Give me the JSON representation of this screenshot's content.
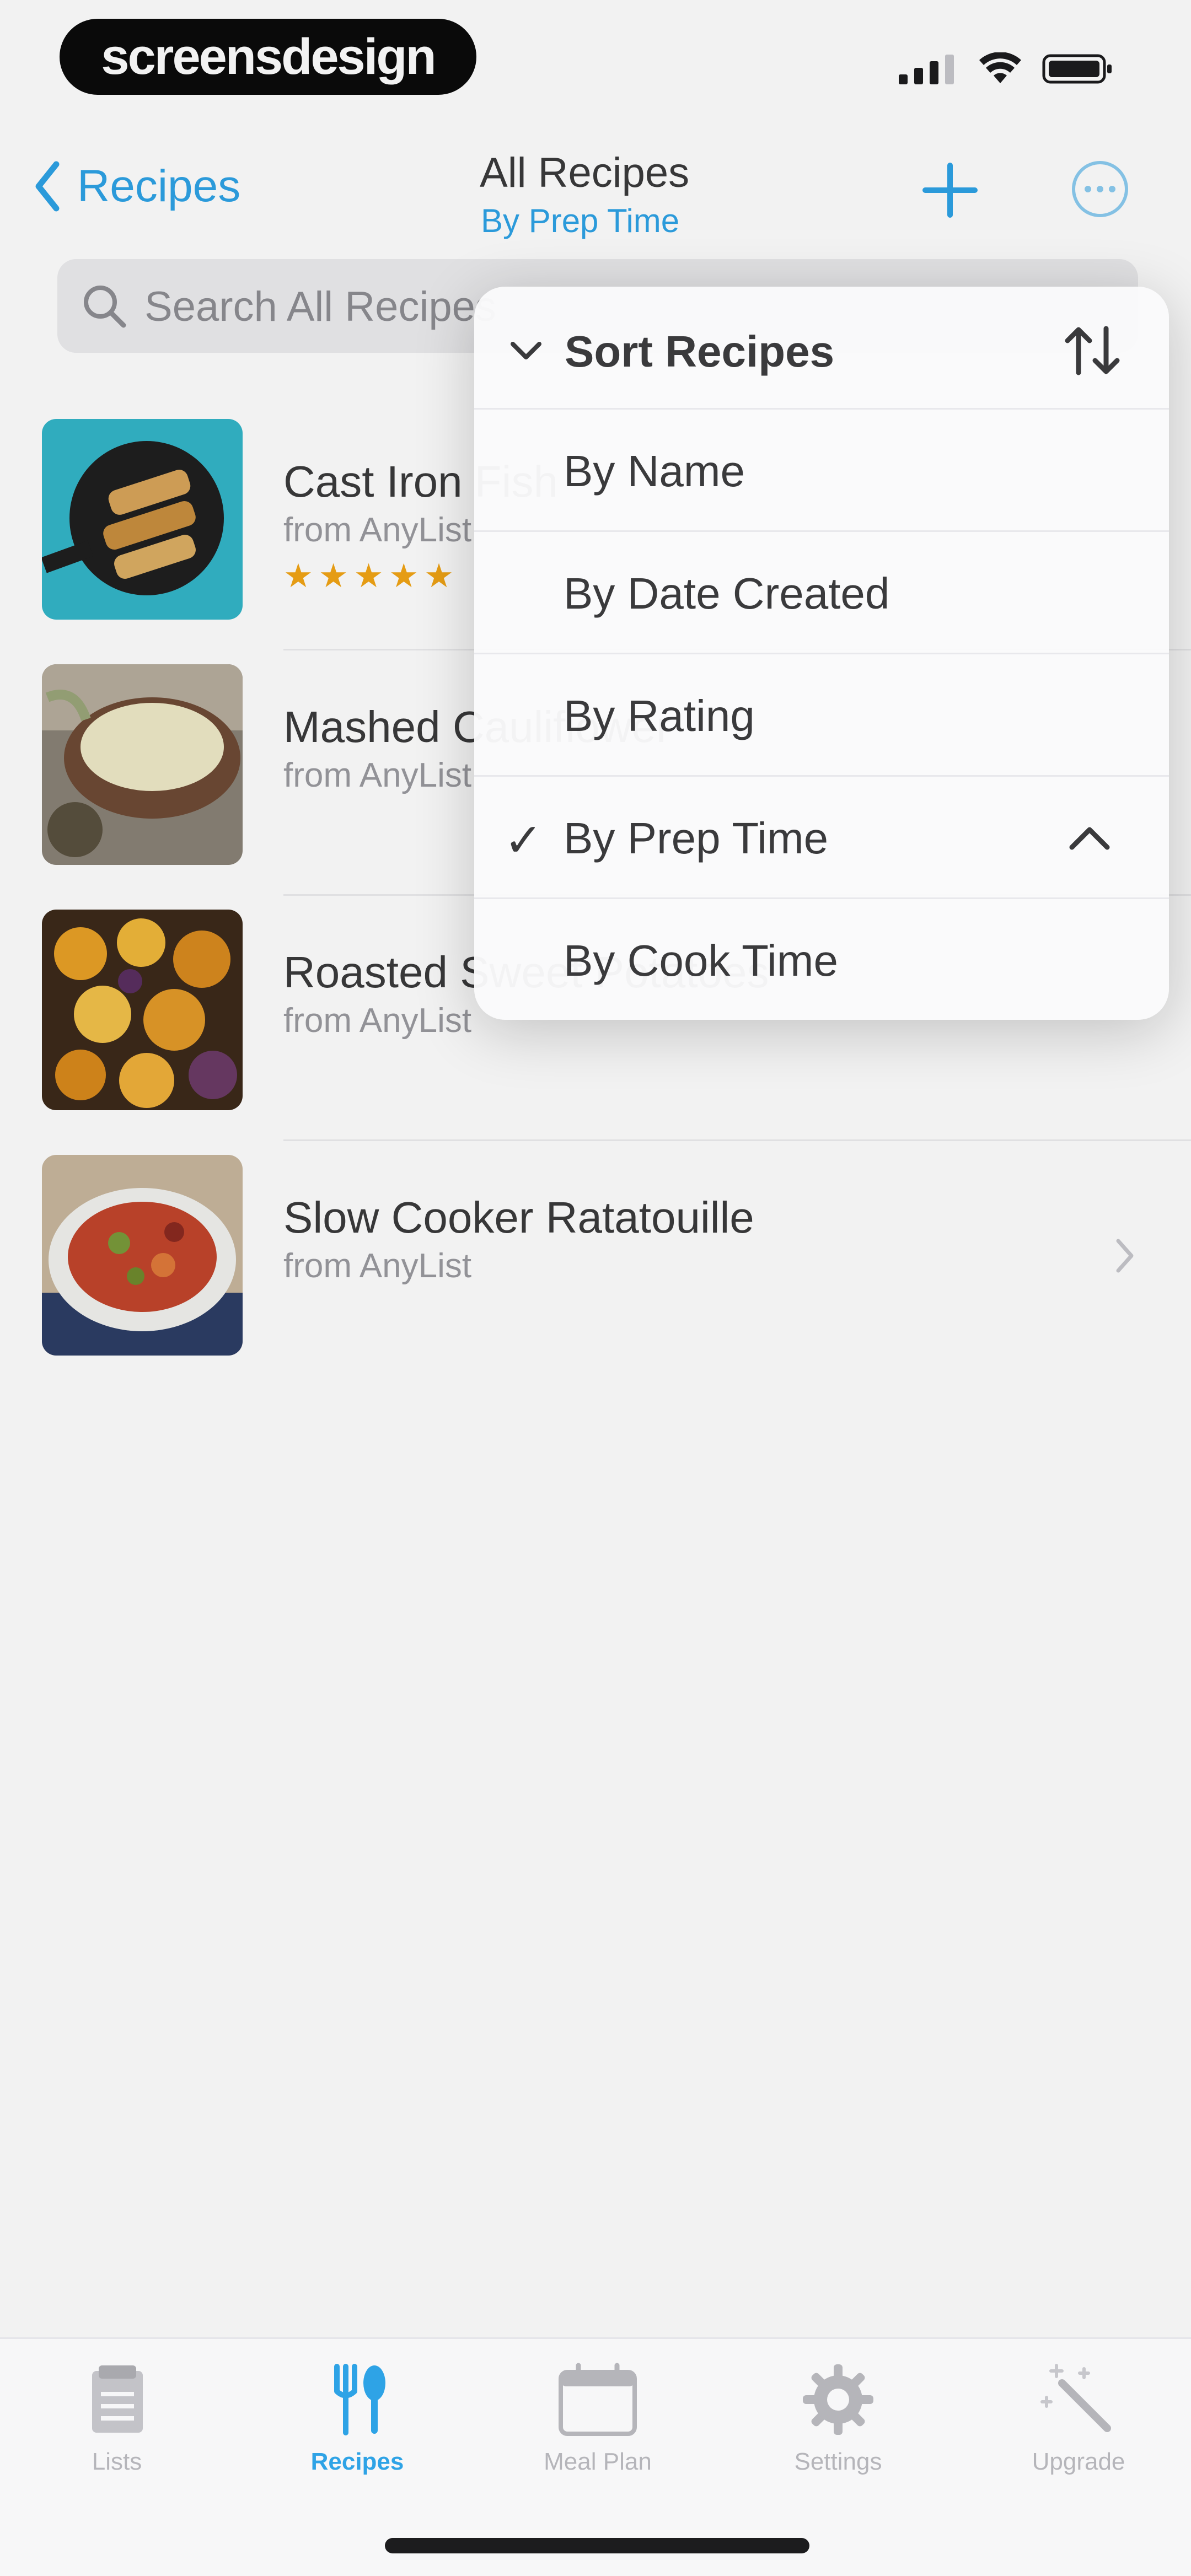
{
  "status_bar": {
    "watermark_text": "screensdesign"
  },
  "nav": {
    "back_label": "Recipes",
    "title": "All Recipes",
    "subtitle": "By Prep Time"
  },
  "search": {
    "placeholder": "Search All Recipes"
  },
  "recipes": [
    {
      "name": "Cast Iron Fish",
      "source": "from AnyList",
      "rating": "★★★★★",
      "stars": 5
    },
    {
      "name": "Mashed Cauliflower",
      "source": "from AnyList"
    },
    {
      "name": "Roasted Sweet Potatoes",
      "source": "from AnyList"
    },
    {
      "name": "Slow Cooker Ratatouille",
      "source": "from AnyList"
    }
  ],
  "sort_menu": {
    "title": "Sort Recipes",
    "options": [
      {
        "label": "By Name",
        "selected": false
      },
      {
        "label": "By Date Created",
        "selected": false
      },
      {
        "label": "By Rating",
        "selected": false
      },
      {
        "label": "By Prep Time",
        "selected": true,
        "checkmark": "✓"
      },
      {
        "label": "By Cook Time",
        "selected": false
      }
    ]
  },
  "tabs": [
    {
      "label": "Lists",
      "icon": "lists-icon",
      "active": false
    },
    {
      "label": "Recipes",
      "icon": "fork-spoon-icon",
      "active": true
    },
    {
      "label": "Meal Plan",
      "icon": "calendar-icon",
      "active": false
    },
    {
      "label": "Settings",
      "icon": "gear-icon",
      "active": false
    },
    {
      "label": "Upgrade",
      "icon": "magic-wand-icon",
      "active": false
    }
  ],
  "colors": {
    "accent": "#2ea3e6",
    "star": "#f2a516",
    "text_primary": "#3a3a3c",
    "text_secondary": "#9a9aa0",
    "tab_inactive": "#b5b5ba"
  }
}
